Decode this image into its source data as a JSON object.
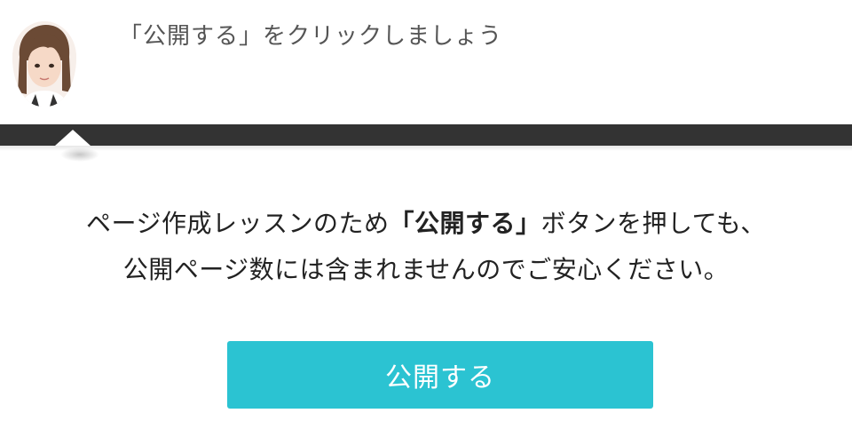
{
  "guide": {
    "avatar_icon": "woman-portrait-avatar",
    "instruction": "「公開する」をクリックしましょう"
  },
  "message": {
    "line1_before": "ページ作成レッスンのため",
    "line1_bold": "「公開する」",
    "line1_after": "ボタンを押しても、",
    "line2": "公開ページ数には含まれませんのでご安心ください。"
  },
  "publish_button": {
    "label": "公開する",
    "color": "#2bc3d2"
  },
  "colors": {
    "strip": "#333333",
    "text": "#222222",
    "guide_text": "#555555"
  }
}
